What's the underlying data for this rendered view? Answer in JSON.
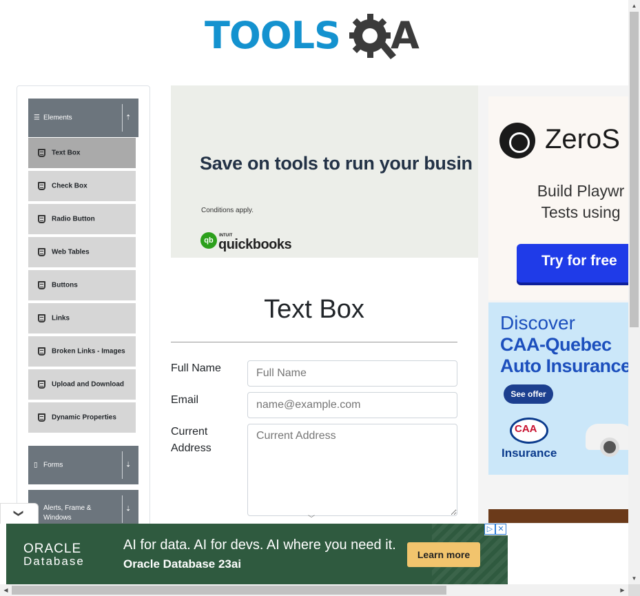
{
  "logo": {
    "left": "TOOLS",
    "right": "A",
    "brand_color": "#1492cf"
  },
  "sidebar": {
    "groups": [
      {
        "label": "Elements",
        "icon": "hamburger-icon",
        "arrow": "collapse-up-icon"
      },
      {
        "label": "Forms",
        "icon": "doc-icon",
        "arrow": "expand-down-icon"
      },
      {
        "label": "Alerts, Frame & Windows",
        "icon": "doc-icon",
        "arrow": "expand-down-icon"
      }
    ],
    "items": [
      {
        "label": "Text Box",
        "active": true
      },
      {
        "label": "Check Box"
      },
      {
        "label": "Radio Button"
      },
      {
        "label": "Web Tables"
      },
      {
        "label": "Buttons"
      },
      {
        "label": "Links"
      },
      {
        "label": "Broken Links - Images"
      },
      {
        "label": "Upload and Download"
      },
      {
        "label": "Dynamic Properties"
      }
    ]
  },
  "ad_top": {
    "headline": "Save on tools to run your busin",
    "conditions": "Conditions apply.",
    "brand_small": "INTUIT",
    "brand": "quickbooks",
    "brand_badge": "qb"
  },
  "ad_zero": {
    "name": "ZeroS",
    "line1": "Build Playwr",
    "line2": "Tests using",
    "cta": "Try for free"
  },
  "ad_caa": {
    "line1": "Discover",
    "line2": "CAA-Quebec",
    "line3": "Auto Insurance",
    "cta": "See offer",
    "logo": "CAA",
    "logo_sub": "Insurance"
  },
  "main": {
    "title": "Text Box",
    "fields": {
      "full_name_label": "Full Name",
      "full_name_placeholder": "Full Name",
      "email_label": "Email",
      "email_placeholder": "name@example.com",
      "address_label_1": "Current",
      "address_label_2": "Address",
      "address_placeholder": "Current Address"
    }
  },
  "ad_oracle": {
    "brand": "ORACLE",
    "product": "Database",
    "tagline": "AI for data. AI for devs. AI where you need it.",
    "subline": "Oracle Database 23ai",
    "cta": "Learn more",
    "adchoices": "▷",
    "close": "✕"
  },
  "collapse_tab": "❯"
}
